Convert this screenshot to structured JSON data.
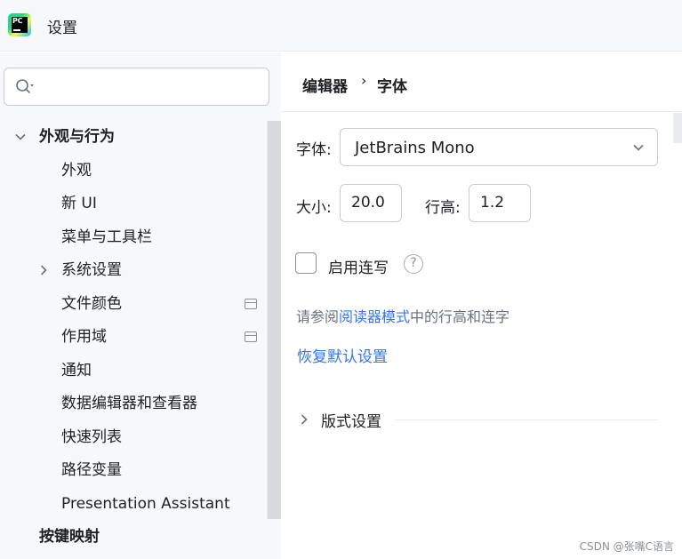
{
  "window": {
    "title": "设置"
  },
  "sidebar": {
    "search": {
      "placeholder": ""
    },
    "items": [
      {
        "label": "外观与行为"
      },
      {
        "label": "外观"
      },
      {
        "label": "新 UI"
      },
      {
        "label": "菜单与工具栏"
      },
      {
        "label": "系统设置"
      },
      {
        "label": "文件颜色"
      },
      {
        "label": "作用域"
      },
      {
        "label": "通知"
      },
      {
        "label": "数据编辑器和查看器"
      },
      {
        "label": "快速列表"
      },
      {
        "label": "路径变量"
      },
      {
        "label": "Presentation Assistant"
      },
      {
        "label": "按键映射"
      }
    ]
  },
  "breadcrumb": {
    "parent": "编辑器",
    "separator": "›",
    "current": "字体"
  },
  "font": {
    "label": "字体:",
    "value": "JetBrains Mono",
    "size_label": "大小:",
    "size_value": "20.0",
    "line_height_label": "行高:",
    "line_height_value": "1.2",
    "ligatures_label": "启用连写",
    "help_glyph": "?",
    "hint_prefix": "请参阅",
    "hint_link": "阅读器模式",
    "hint_suffix": "中的行高和连字",
    "reset_label": "恢复默认设置",
    "section_label": "版式设置"
  },
  "watermark": "CSDN @张嘴C语言",
  "colors": {
    "accent": "#3574f0",
    "sidebar_bg": "#f7f8fa",
    "border": "#c9ccd6"
  },
  "icons": {
    "app": "pycharm-logo-icon",
    "search": "search-icon",
    "help": "help-icon"
  }
}
